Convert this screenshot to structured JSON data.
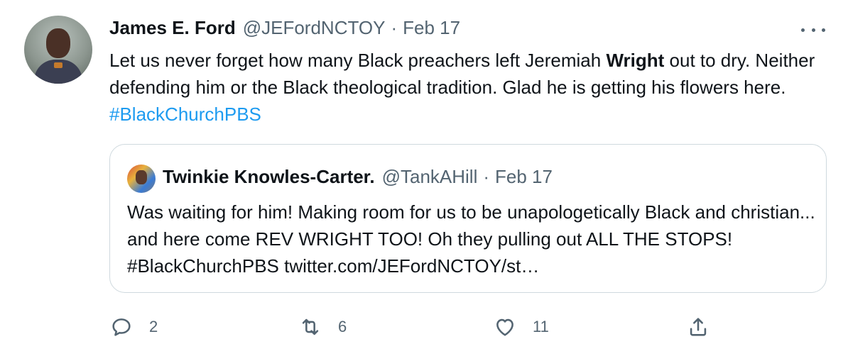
{
  "tweet": {
    "author_name": "James E. Ford",
    "author_handle": "@JEFordNCTOY",
    "separator": "·",
    "date": "Feb 17",
    "text_before": "Let us never forget how many Black preachers left Jeremiah ",
    "text_bold": "Wright",
    "text_after": " out to dry. Neither defending him or the Black theological tradition. Glad he is getting his flowers here. ",
    "hashtag": "#BlackChurchPBS"
  },
  "quote": {
    "author_name": "Twinkie Knowles-Carter.",
    "author_handle": "@TankAHill",
    "separator": "·",
    "date": "Feb 17",
    "text": "Was waiting for him!  Making room for us to be unapologetically Black and christian... and here come REV WRIGHT TOO!  Oh they pulling out ALL THE STOPS! #BlackChurchPBS twitter.com/JEFordNCTOY/st…"
  },
  "actions": {
    "reply_count": "2",
    "retweet_count": "6",
    "like_count": "11"
  },
  "icons": {
    "more": "more-horizontal-icon",
    "reply": "reply-icon",
    "retweet": "retweet-icon",
    "like": "heart-icon",
    "share": "share-icon"
  },
  "colors": {
    "text": "#0f1419",
    "secondary": "#536471",
    "link": "#1d9bf0",
    "border": "#cfd9de"
  }
}
